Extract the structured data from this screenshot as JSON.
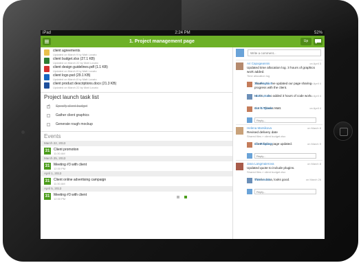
{
  "status": {
    "carrier": "iPad",
    "time": "2:24 PM",
    "battery": "52%"
  },
  "topbar": {
    "title": "1. Project management page",
    "up_label": "Up"
  },
  "files": [
    {
      "name": "client agreements",
      "meta": "Updated on March 9 by Matt Lovato",
      "icon": "folder-icon",
      "color": "#e8c04c"
    },
    {
      "name": "client budget.xlsx (27.1 KB)",
      "meta": "Updated on March 22 by Matt Lovato",
      "icon": "excel-icon",
      "color": "#2e7d32"
    },
    {
      "name": "client design guidelines.pdf (1.1 KB)",
      "meta": "Updated on March 8 by Matt Lovato",
      "icon": "pdf-icon",
      "color": "#d32f2f"
    },
    {
      "name": "client logo.psd (29.1 KB)",
      "meta": "Updated on March 8 by Matt Lovato",
      "icon": "photoshop-icon",
      "color": "#1565c0"
    },
    {
      "name": "client product descriptions.docx (21.3 KB)",
      "meta": "Updated on March 22 by Matt Lovato",
      "icon": "word-icon",
      "color": "#1e4f9c"
    }
  ],
  "tasklist": {
    "title": "Project launch task list",
    "items": [
      {
        "label": "Specify client budget",
        "done": true
      },
      {
        "label": "Gather client graphics",
        "done": false
      },
      {
        "label": "Generate rough mockup",
        "done": false
      }
    ]
  },
  "events": {
    "title": "Events",
    "groups": [
      {
        "date": "March 22, 2013",
        "items": [
          {
            "day": "31",
            "title": "Client promotion",
            "time": "11:30 AM"
          }
        ]
      },
      {
        "date": "March 25, 2013",
        "items": [
          {
            "day": "31",
            "title": "Meeting #3 with client",
            "time": "12:30 PM"
          }
        ]
      },
      {
        "date": "April 1, 2013",
        "items": [
          {
            "day": "31",
            "title": "Client online advertising campaign",
            "time": "11:30 AM"
          }
        ]
      },
      {
        "date": "April 5, 2013",
        "items": [
          {
            "day": "31",
            "title": "Meeting #3 with client",
            "time": "12:30 PM"
          }
        ]
      }
    ]
  },
  "comments": {
    "placeholder": "Write a comment...",
    "posts": [
      {
        "author": "Ari Capogeannis",
        "date": "on April 3",
        "body": "Updated time allocation log. 3 hours of graphics work added.",
        "sub": "Time allocation log",
        "avatar": "#b58a6e",
        "replies": [
          {
            "author": "Jim Ringham",
            "date": "on April 4",
            "body": "Thanks Ari. I've updated our page sharing progress with the client.",
            "avatar": "#c47c5a"
          },
          {
            "author": "Matt Lovato",
            "date": "on April 4",
            "body": "Hi Jim, I also added 3 hours of code work.",
            "avatar": "#6b8fb8"
          },
          {
            "author": "Jim Ringham",
            "date": "on April 4",
            "body": "Got it. Thanks Matt.",
            "avatar": "#c47c5a"
          }
        ]
      },
      {
        "author": "Helena Marsikova",
        "date": "on March 8",
        "body": "Revised delivery date",
        "sub": "Shared files » client budget.xlsx",
        "avatar": "#c9a27a",
        "replies": [
          {
            "author": "Jim Ringham",
            "date": "on March 9",
            "body": "Client-facing page updated.",
            "avatar": "#c47c5a"
          }
        ]
      },
      {
        "author": "Jana Langmaierova",
        "date": "on March 8",
        "body": "Updated quote to include plugins.",
        "sub": "Shared files » client budget.xlsx",
        "avatar": "#a85b4a",
        "replies": [
          {
            "author": "Matt Lovato",
            "date": "on March 26",
            "body": "Thanks Jana, looks good.",
            "avatar": "#6b8fb8"
          }
        ]
      }
    ],
    "reply_placeholder": "Reply..."
  }
}
